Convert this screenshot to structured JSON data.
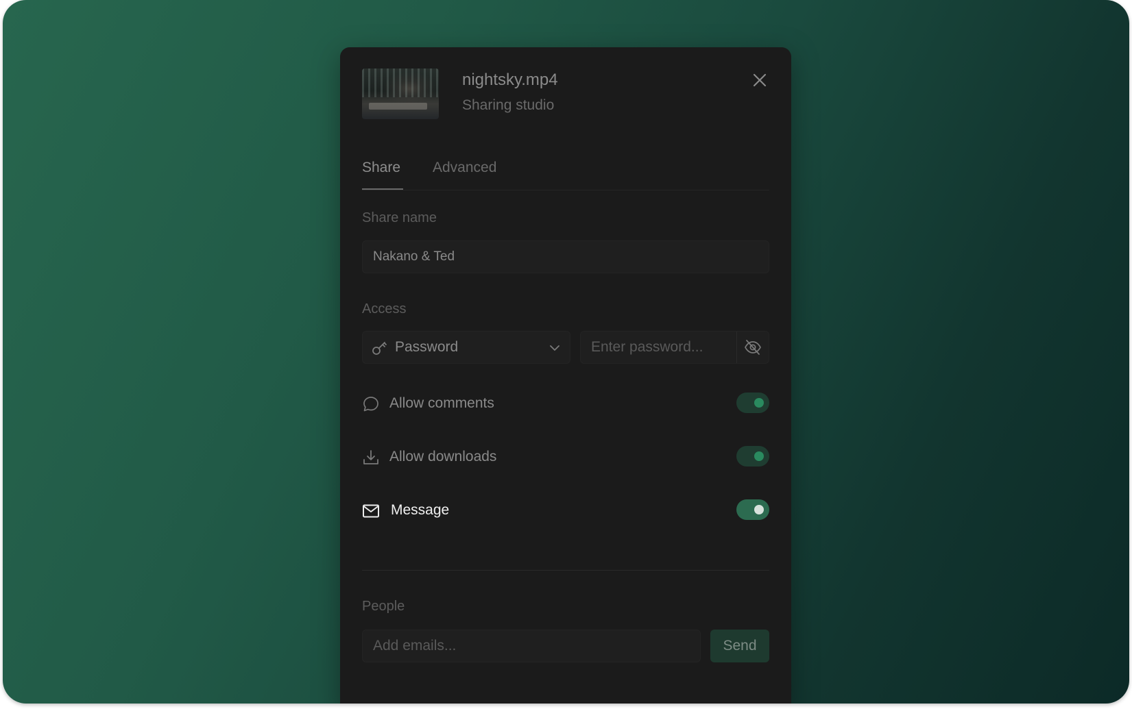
{
  "file": {
    "name": "nightsky.mp4",
    "subtitle": "Sharing studio"
  },
  "tabs": [
    {
      "label": "Share",
      "active": true
    },
    {
      "label": "Advanced",
      "active": false
    }
  ],
  "share_name": {
    "label": "Share name",
    "value": "Nakano & Ted"
  },
  "access": {
    "label": "Access",
    "type_selected": "Password",
    "password_placeholder": "Enter password..."
  },
  "options": [
    {
      "label": "Allow comments",
      "icon": "comment-icon",
      "enabled": true
    },
    {
      "label": "Allow downloads",
      "icon": "download-icon",
      "enabled": true
    },
    {
      "label": "Message",
      "icon": "mail-icon",
      "enabled": true
    }
  ],
  "people": {
    "label": "People",
    "placeholder": "Add emails...",
    "send_label": "Send"
  },
  "colors": {
    "accent": "#2a8a5f",
    "background_start": "#27664e",
    "background_end": "#0c2a27",
    "dialog": "#1b1b1b"
  }
}
